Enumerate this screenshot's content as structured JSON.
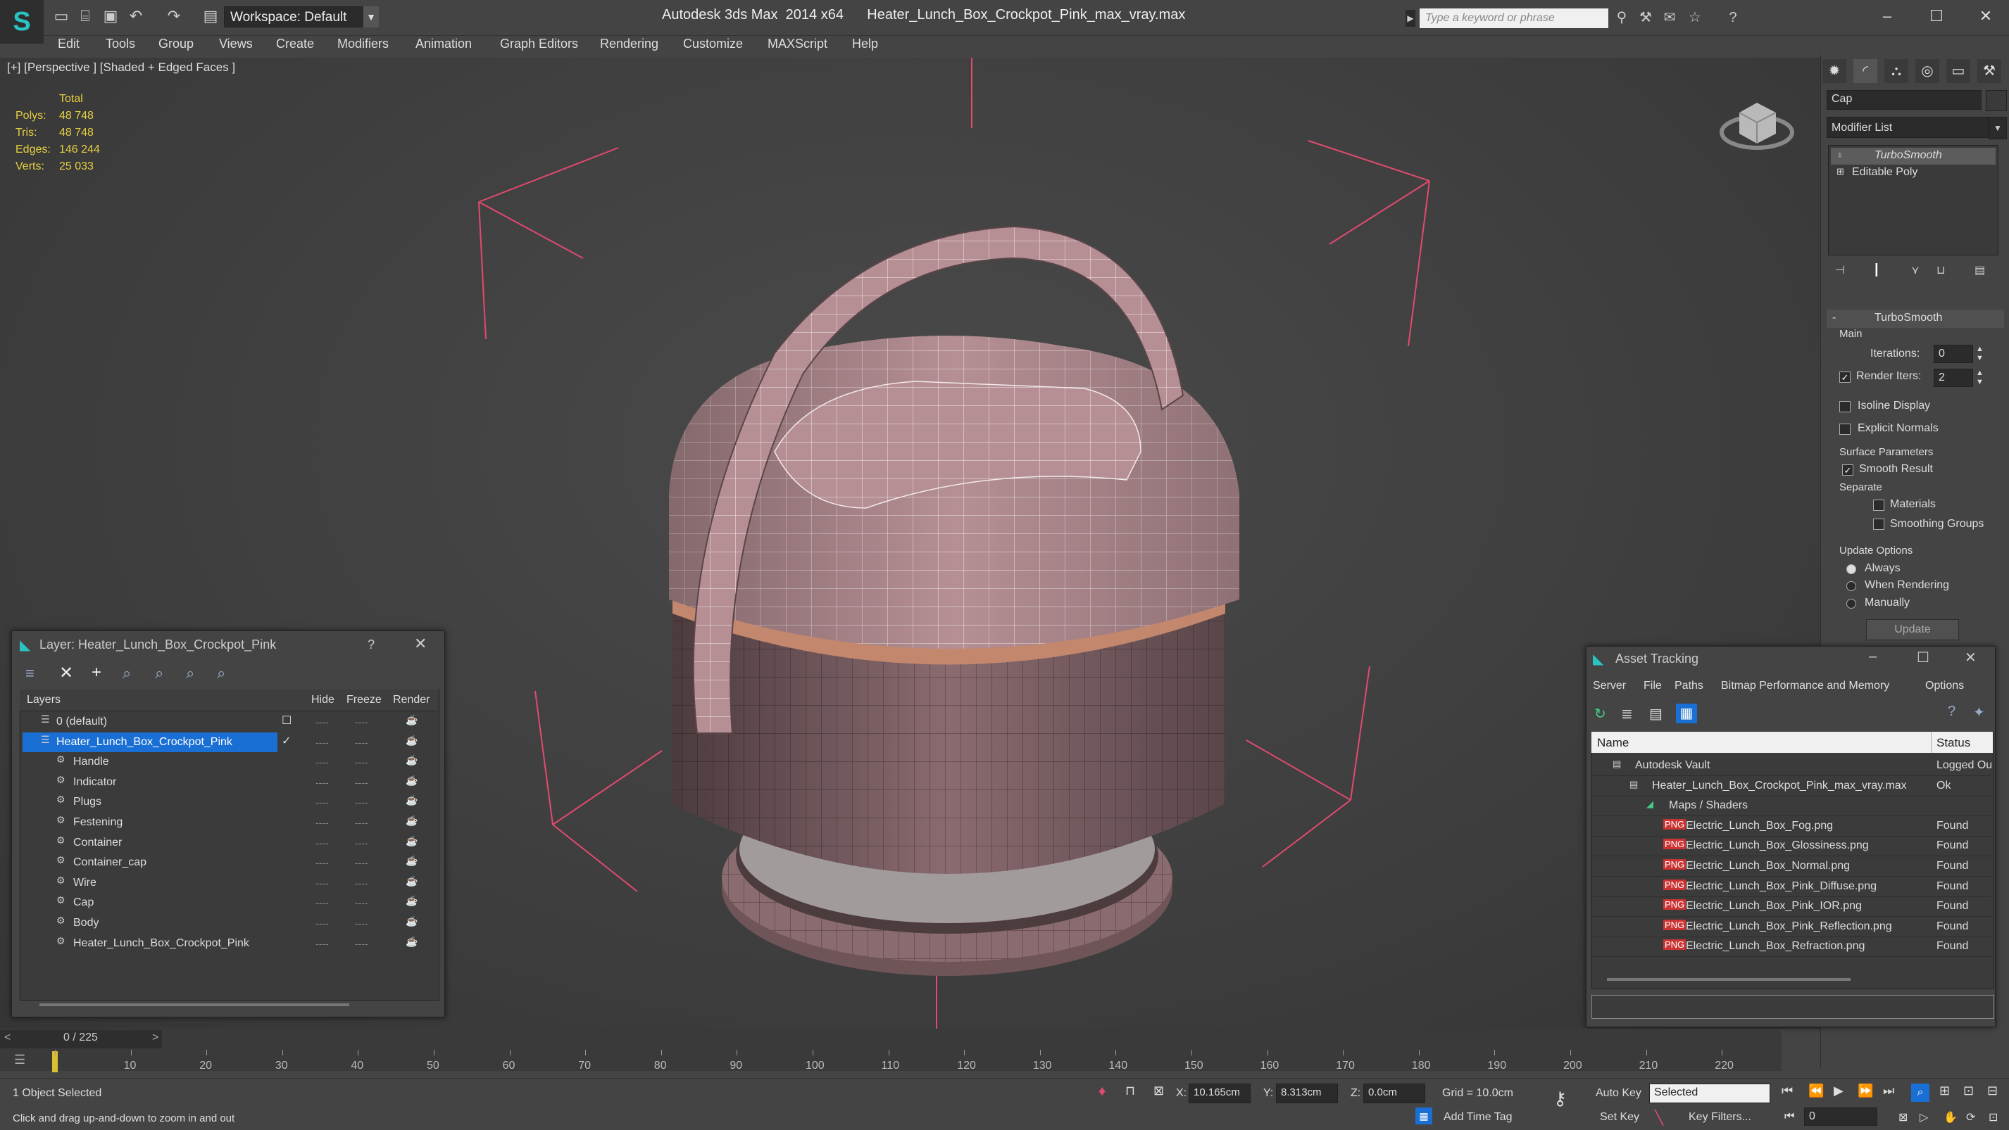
{
  "title_bar": {
    "app_title": "Autodesk 3ds Max  2014 x64",
    "file_title": "Heater_Lunch_Box_Crockpot_Pink_max_vray.max",
    "workspace_label": "Workspace: Default",
    "search_placeholder": "Type a keyword or phrase"
  },
  "menu": [
    "Edit",
    "Tools",
    "Group",
    "Views",
    "Create",
    "Modifiers",
    "Animation",
    "Graph Editors",
    "Rendering",
    "Customize",
    "MAXScript",
    "Help"
  ],
  "viewport": {
    "label": "[+] [Perspective ] [Shaded + Edged Faces ]",
    "stats_header": "Total",
    "stats": [
      {
        "label": "Polys:",
        "value": "48 748"
      },
      {
        "label": "Tris:",
        "value": "48 748"
      },
      {
        "label": "Edges:",
        "value": "146 244"
      },
      {
        "label": "Verts:",
        "value": "25 033"
      }
    ],
    "accent_color": "#e24a6e",
    "model_color": "#b58f94"
  },
  "command_panel": {
    "object_name": "Cap",
    "modifier_list_label": "Modifier List",
    "stack": [
      "TurboSmooth",
      "Editable Poly"
    ],
    "rollout_title": "TurboSmooth",
    "main_label": "Main",
    "iterations_label": "Iterations:",
    "iterations_value": "0",
    "render_iters_label": "Render Iters:",
    "render_iters_value": "2",
    "isoline_label": "Isoline Display",
    "explicit_normals_label": "Explicit Normals",
    "surface_params_label": "Surface Parameters",
    "smooth_result_label": "Smooth Result",
    "separate_label": "Separate",
    "materials_label": "Materials",
    "smoothing_groups_label": "Smoothing Groups",
    "update_options_label": "Update Options",
    "always_label": "Always",
    "when_rendering_label": "When Rendering",
    "manually_label": "Manually",
    "update_button": "Update"
  },
  "layer_panel": {
    "title": "Layer: Heater_Lunch_Box_Crockpot_Pink",
    "help": "?",
    "columns": {
      "layers": "Layers",
      "hide": "Hide",
      "freeze": "Freeze",
      "render": "Render"
    },
    "rows": [
      {
        "name": "0 (default)",
        "level": 1
      },
      {
        "name": "Heater_Lunch_Box_Crockpot_Pink",
        "level": 1,
        "selected": true
      },
      {
        "name": "Handle",
        "level": 2
      },
      {
        "name": "Indicator",
        "level": 2
      },
      {
        "name": "Plugs",
        "level": 2
      },
      {
        "name": "Festening",
        "level": 2
      },
      {
        "name": "Container",
        "level": 2
      },
      {
        "name": "Container_cap",
        "level": 2
      },
      {
        "name": "Wire",
        "level": 2
      },
      {
        "name": "Cap",
        "level": 2
      },
      {
        "name": "Body",
        "level": 2
      },
      {
        "name": "Heater_Lunch_Box_Crockpot_Pink",
        "level": 2
      }
    ],
    "dash": "----"
  },
  "asset_panel": {
    "title": "Asset Tracking",
    "menu": [
      "Server",
      "File",
      "Paths",
      "Bitmap Performance and Memory",
      "Options"
    ],
    "columns": {
      "name": "Name",
      "status": "Status"
    },
    "rows": [
      {
        "name": "Autodesk Vault",
        "status": "Logged Ou",
        "level": 0
      },
      {
        "name": "Heater_Lunch_Box_Crockpot_Pink_max_vray.max",
        "status": "Ok",
        "level": 1
      },
      {
        "name": "Maps / Shaders",
        "status": "",
        "level": 2
      },
      {
        "name": "Electric_Lunch_Box_Fog.png",
        "status": "Found",
        "level": 3
      },
      {
        "name": "Electric_Lunch_Box_Glossiness.png",
        "status": "Found",
        "level": 3
      },
      {
        "name": "Electric_Lunch_Box_Normal.png",
        "status": "Found",
        "level": 3
      },
      {
        "name": "Electric_Lunch_Box_Pink_Diffuse.png",
        "status": "Found",
        "level": 3
      },
      {
        "name": "Electric_Lunch_Box_Pink_IOR.png",
        "status": "Found",
        "level": 3
      },
      {
        "name": "Electric_Lunch_Box_Pink_Reflection.png",
        "status": "Found",
        "level": 3
      },
      {
        "name": "Electric_Lunch_Box_Refraction.png",
        "status": "Found",
        "level": 3
      }
    ]
  },
  "timeline": {
    "frame_label": "0 / 225",
    "ticks": [
      "0",
      "10",
      "20",
      "30",
      "40",
      "50",
      "60",
      "70",
      "80",
      "90",
      "100",
      "110",
      "120",
      "130",
      "140",
      "150",
      "160",
      "170",
      "180",
      "190",
      "200",
      "210",
      "220"
    ]
  },
  "status_bar": {
    "selection": "1 Object Selected",
    "prompt": "Click and drag up-and-down to zoom in and out",
    "x_label": "X:",
    "x_value": "10.165cm",
    "y_label": "Y:",
    "y_value": "8.313cm",
    "z_label": "Z:",
    "z_value": "0.0cm",
    "grid": "Grid = 10.0cm",
    "add_time_tag": "Add Time Tag",
    "auto_key": "Auto Key",
    "set_key": "Set Key",
    "selected_option": "Selected",
    "key_filters": "Key Filters...",
    "frame_value": "0"
  }
}
